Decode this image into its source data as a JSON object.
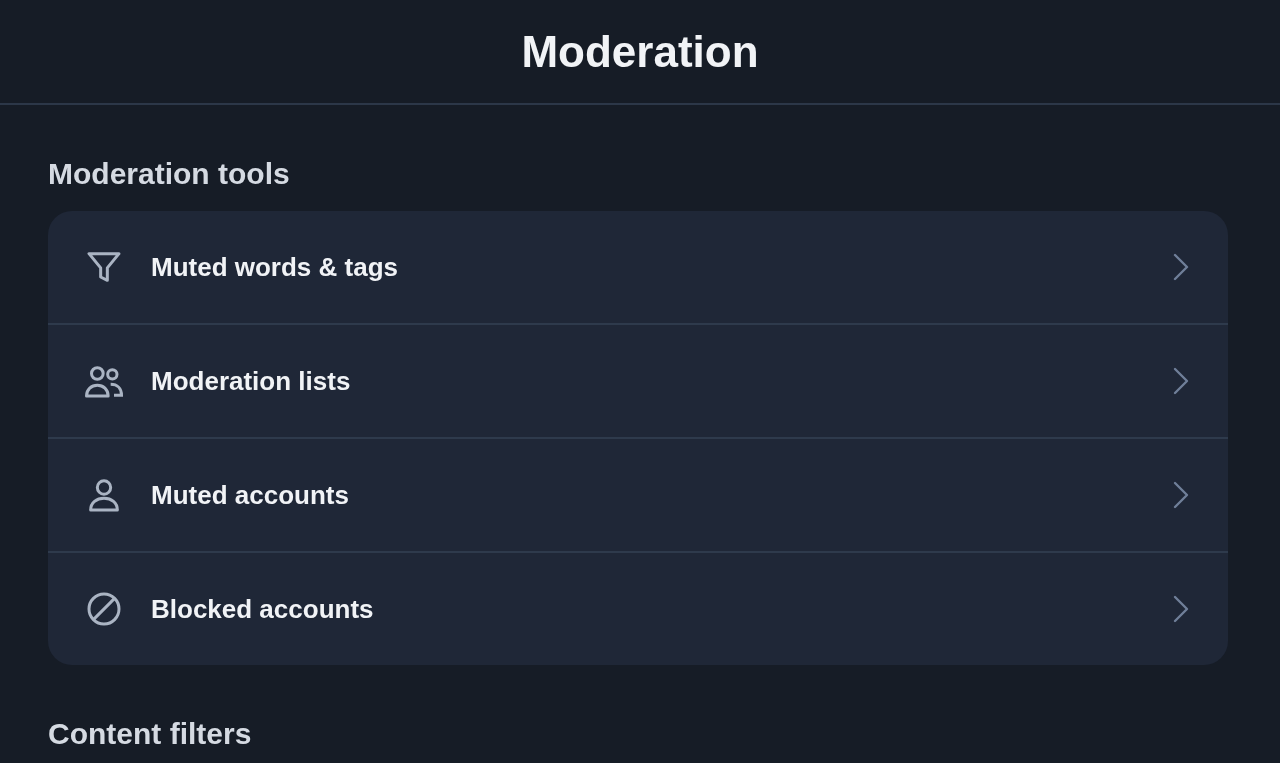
{
  "header": {
    "title": "Moderation"
  },
  "sections": [
    {
      "title": "Moderation tools",
      "items": [
        {
          "label": "Muted words & tags",
          "kind": "filter"
        },
        {
          "label": "Moderation lists",
          "kind": "people"
        },
        {
          "label": "Muted accounts",
          "kind": "person"
        },
        {
          "label": "Blocked accounts",
          "kind": "block"
        }
      ]
    },
    {
      "title": "Content filters"
    }
  ]
}
